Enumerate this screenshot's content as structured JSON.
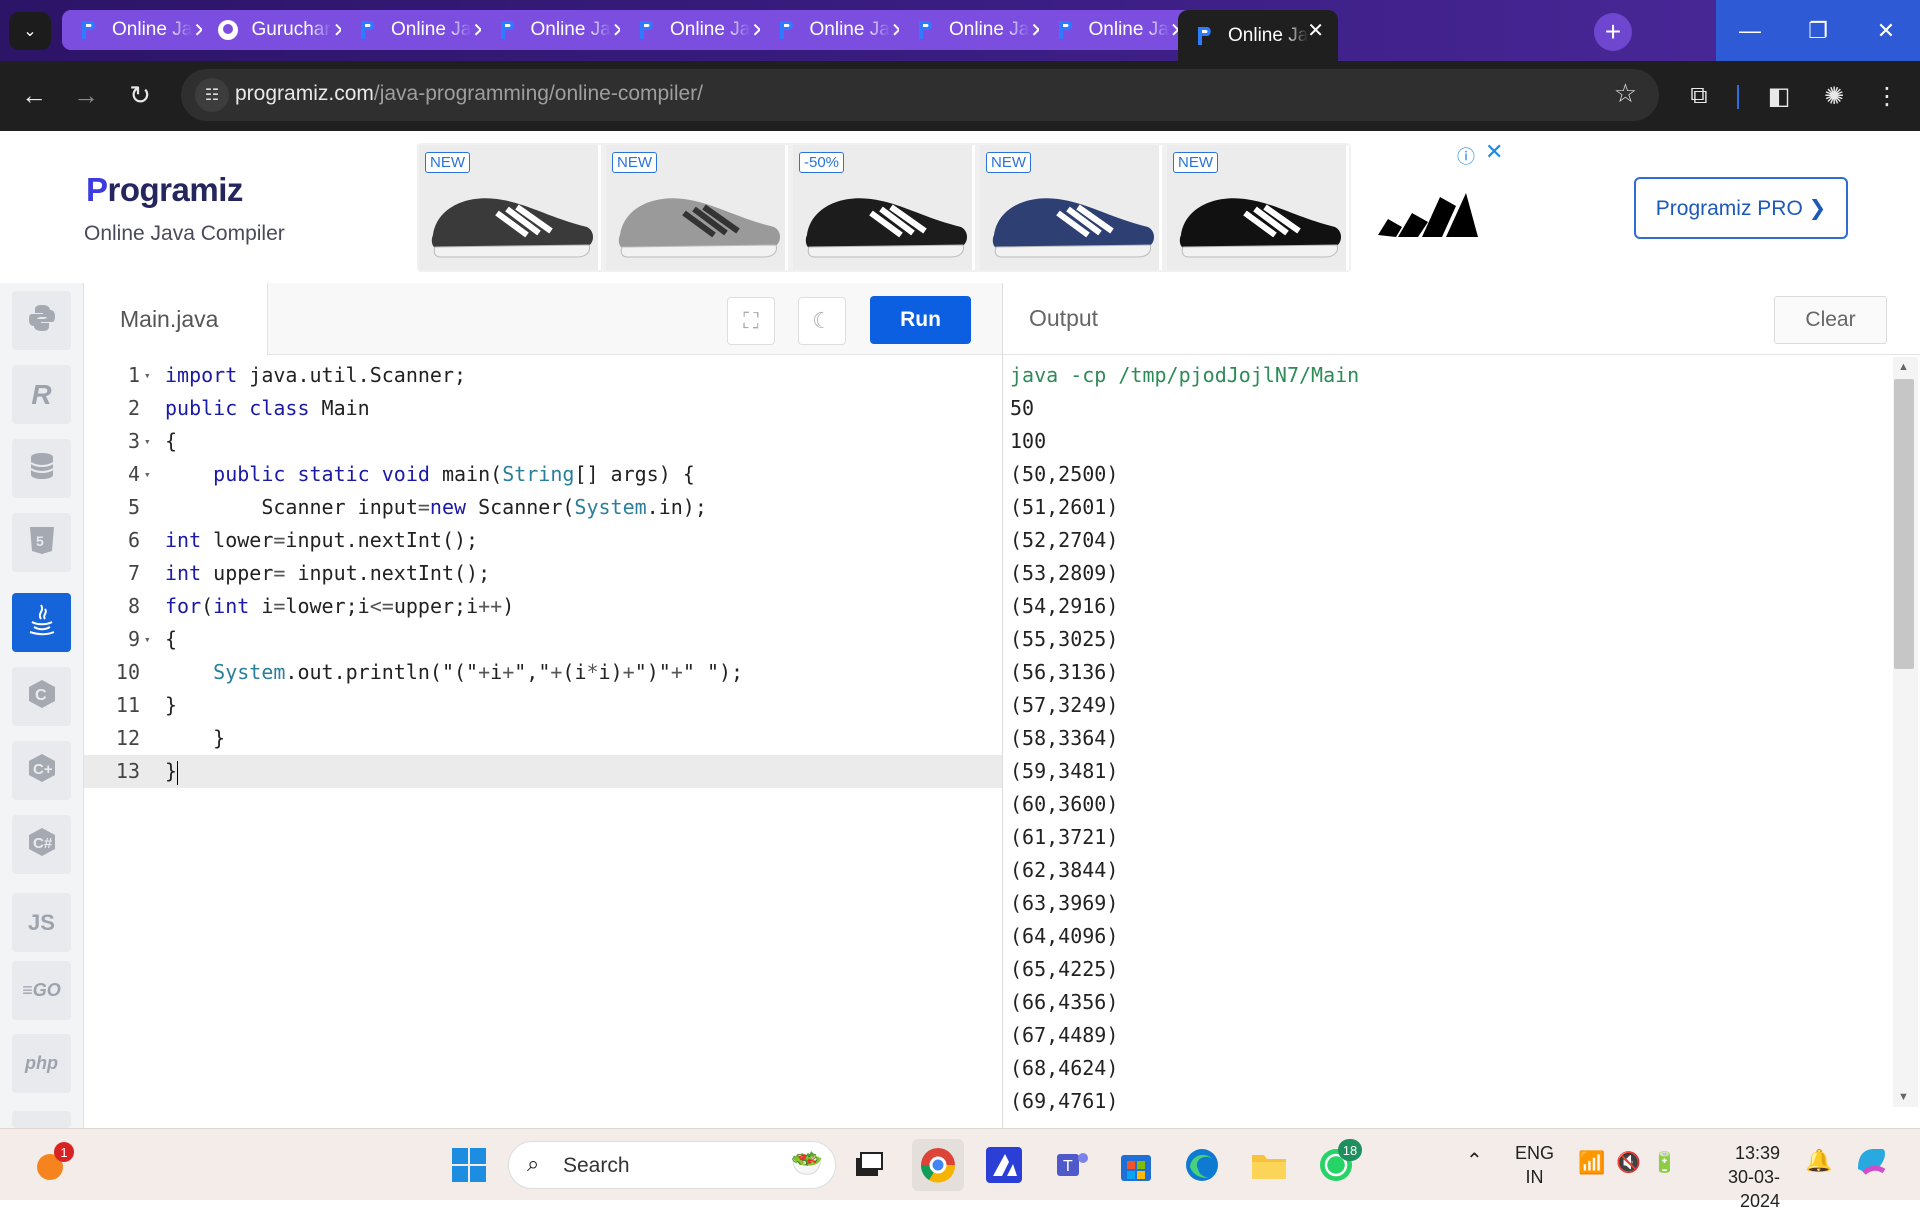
{
  "browser": {
    "tabs": [
      {
        "label": "Online Java Compiler",
        "favicon": "programiz-icon"
      },
      {
        "label": "Guruchar",
        "favicon": "github-icon"
      },
      {
        "label": "Online Java Compiler",
        "favicon": "programiz-icon"
      },
      {
        "label": "Online Java Compiler",
        "favicon": "programiz-icon"
      },
      {
        "label": "Online Java Compiler",
        "favicon": "programiz-icon"
      },
      {
        "label": "Online Java Compiler",
        "favicon": "programiz-icon"
      },
      {
        "label": "Online Java Compiler",
        "favicon": "programiz-icon"
      },
      {
        "label": "Online Java Compiler",
        "favicon": "programiz-icon"
      },
      {
        "label": "Online Java Compiler",
        "favicon": "programiz-icon",
        "active": true
      }
    ],
    "url_host": "programiz.com",
    "url_path": "/java-programming/online-compiler/"
  },
  "header": {
    "logo_text": "rogramiz",
    "logo_p": "P",
    "subtitle": "Online Java Compiler",
    "pro_button": "Programiz PRO ❯",
    "ad_tags": [
      "NEW",
      "NEW",
      "-50%",
      "NEW",
      "NEW"
    ],
    "ad_info": "ⓘ",
    "ad_close": "✕"
  },
  "sidebar": {
    "languages": [
      "python",
      "r",
      "sql",
      "html",
      "java",
      "c",
      "cpp",
      "csharp",
      "JS",
      "GO",
      "php"
    ],
    "active": "java"
  },
  "editor": {
    "filename": "Main.java",
    "run_label": "Run",
    "lines": [
      "import java.util.Scanner;",
      "public class Main",
      "{",
      "    public static void main(String[] args) {",
      "        Scanner input=new Scanner(System.in);",
      "int lower=input.nextInt();",
      "int upper= input.nextInt();",
      "for(int i=lower;i<=upper;i++)",
      "{",
      "    System.out.println(\"(\"+i+\",\"+(i*i)+\")\"+\" \");",
      "}",
      "    }",
      "}"
    ],
    "fold_lines": [
      1,
      3,
      4,
      9
    ],
    "current_line": 13
  },
  "output": {
    "title": "Output",
    "clear_label": "Clear",
    "command": "java -cp /tmp/pjodJojlN7/Main",
    "lines": [
      "50",
      "100",
      "(50,2500)",
      "(51,2601)",
      "(52,2704)",
      "(53,2809)",
      "(54,2916)",
      "(55,3025)",
      "(56,3136)",
      "(57,3249)",
      "(58,3364)",
      "(59,3481)",
      "(60,3600)",
      "(61,3721)",
      "(62,3844)",
      "(63,3969)",
      "(64,4096)",
      "(65,4225)",
      "(66,4356)",
      "(67,4489)",
      "(68,4624)",
      "(69,4761)"
    ]
  },
  "taskbar": {
    "search_label": "Search",
    "notification_count": "1",
    "whatsapp_badge": "18",
    "lang_top": "ENG",
    "lang_bottom": "IN",
    "time": "13:39",
    "date": "30-03-2024"
  },
  "colors": {
    "run_button": "#0b5fe0",
    "active_lang": "#1664d9",
    "tab_bg": "#7b4ee0"
  }
}
